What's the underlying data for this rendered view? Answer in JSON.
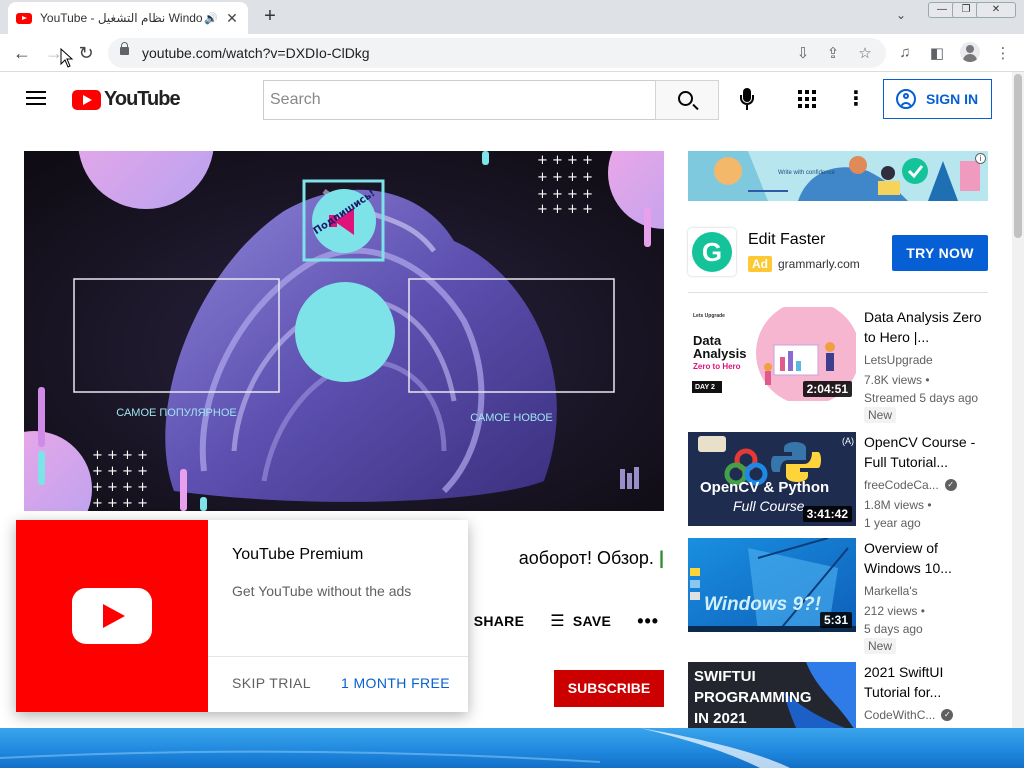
{
  "browser": {
    "tab_title": "YouTube - نظام التشغيل Windows",
    "tab_close": "✕",
    "new_tab": "+",
    "url": "youtube.com/watch?v=DXDIo-ClDkg",
    "win_minimize": "—",
    "win_restore": "❐",
    "win_close": "✕"
  },
  "header": {
    "logo_text": "YouTube",
    "search_placeholder": "Search",
    "signin_label": "SIGN IN"
  },
  "player": {
    "badge_text": "Подпишись!",
    "label_left": "САМОЕ ПОПУЛЯРНОЕ",
    "label_right": "САМОЕ НОВОЕ"
  },
  "video": {
    "title_visible": "аоборот! Обзор.",
    "title_cursor": "|",
    "share_label": "SHARE",
    "save_label": "SAVE",
    "more_label": "•••",
    "subscribe_label": "SUBSCRIBE"
  },
  "premium_popup": {
    "title": "YouTube Premium",
    "subtitle": "Get YouTube without the ads",
    "skip_label": "SKIP TRIAL",
    "free_label": "1 MONTH FREE"
  },
  "ad": {
    "banner_text": "Write with confidence",
    "title": "Edit Faster",
    "badge": "Ad",
    "domain": "grammarly.com",
    "cta": "TRY NOW"
  },
  "recommendations": [
    {
      "title": "Data Analysis Zero to Hero |...",
      "channel": "LetsUpgrade",
      "views": "7.8K views •",
      "age": "Streamed 5 days ago",
      "badge": "New",
      "duration": "2:04:51",
      "thumb_text": {
        "brand": "Lets Upgrade",
        "line1": "Data",
        "line2": "Analysis",
        "line3": "Zero to Hero",
        "day": "DAY 2"
      }
    },
    {
      "title": "OpenCV Course - Full Tutorial...",
      "channel": "freeCodeCa...",
      "views": "1.8M views •",
      "age": "1 year ago",
      "badge": "",
      "duration": "3:41:42",
      "thumb_text": {
        "line1": "OpenCV & Python",
        "line2": "Full Course"
      }
    },
    {
      "title": "Overview of Windows 10...",
      "channel": "Markella's",
      "views": "212 views •",
      "age": "5 days ago",
      "badge": "New",
      "duration": "5:31",
      "thumb_text": {
        "line1": "Windows 9?!"
      }
    },
    {
      "title": "2021 SwiftUI Tutorial for...",
      "channel": "CodeWithC...",
      "views": "",
      "age": "",
      "badge": "",
      "duration": "",
      "thumb_text": {
        "line1": "SWIFTUI",
        "line2": "PROGRAMMING",
        "line3": "IN 2021"
      }
    }
  ],
  "colors": {
    "yt_red": "#ff0000",
    "link_blue": "#065fd4",
    "subscribe_red": "#cc0000",
    "grammarly_green": "#15c39a",
    "ad_yellow": "#fcc934"
  }
}
